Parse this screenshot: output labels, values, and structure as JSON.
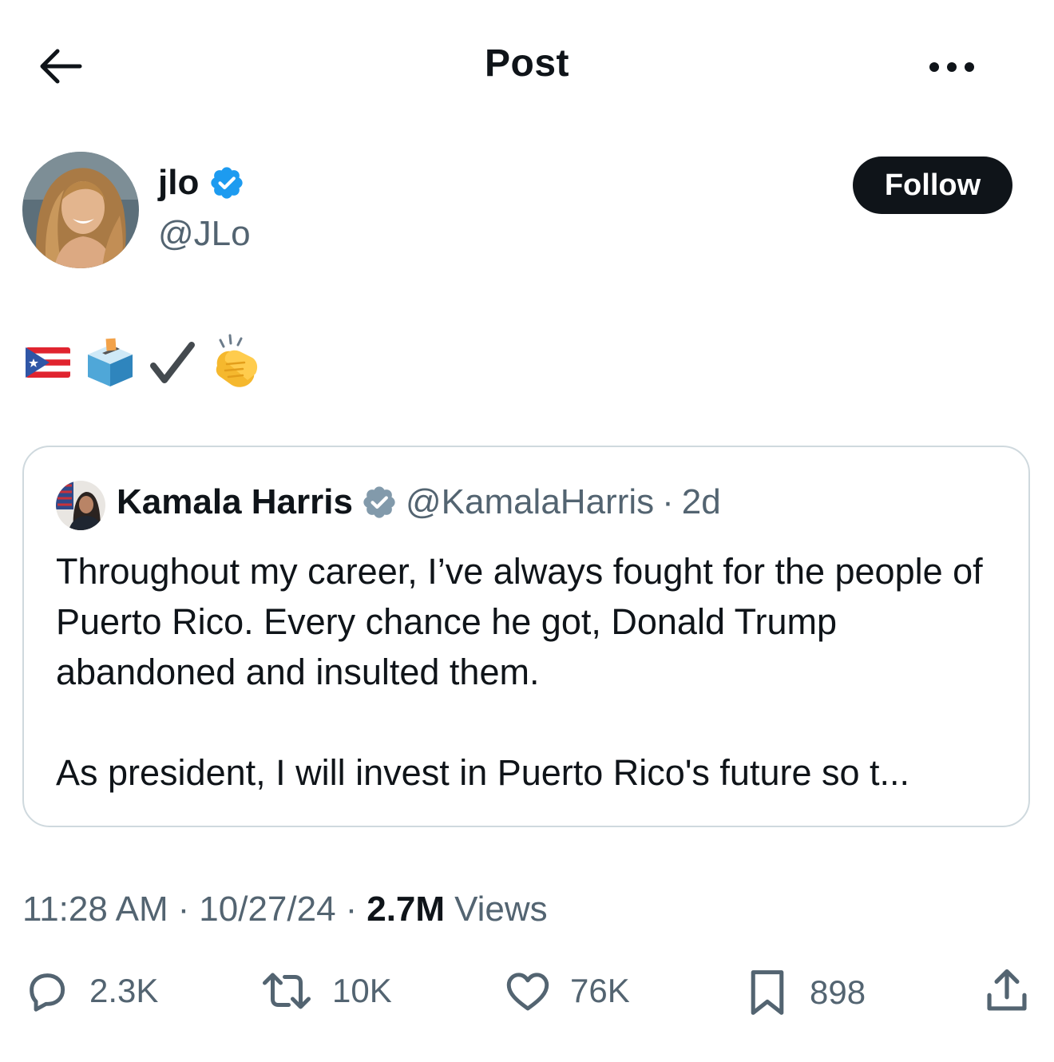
{
  "header": {
    "title": "Post",
    "back_icon": "arrow-left-icon",
    "more_icon": "more-horizontal-icon"
  },
  "author": {
    "display_name": "jlo",
    "handle": "@JLo",
    "verified_icon": "verified-badge-icon",
    "follow_label": "Follow"
  },
  "post": {
    "emojis": [
      "puerto-rico-flag-icon",
      "ballot-box-icon",
      "check-mark-icon",
      "clapping-hands-icon"
    ]
  },
  "quote": {
    "display_name": "Kamala Harris",
    "handle": "@KamalaHarris",
    "separator": "·",
    "time": "2d",
    "text": "Throughout my career, I’ve always fought for the people of Puerto Rico. Every chance he got, Donald Trump abandoned and insulted them.\n\nAs president, I will invest in Puerto Rico's future so t..."
  },
  "meta": {
    "time": "11:28 AM",
    "sep1": "·",
    "date": "10/27/24",
    "sep2": "·",
    "views_count": "2.7M",
    "views_label": "Views"
  },
  "actions": {
    "replies": "2.3K",
    "reposts": "10K",
    "likes": "76K",
    "bookmarks": "898"
  },
  "colors": {
    "text_primary": "#0f1419",
    "text_secondary": "#536471",
    "verified_blue": "#1d9bf0",
    "verified_gray": "#829aab",
    "border": "#cfd9de"
  }
}
